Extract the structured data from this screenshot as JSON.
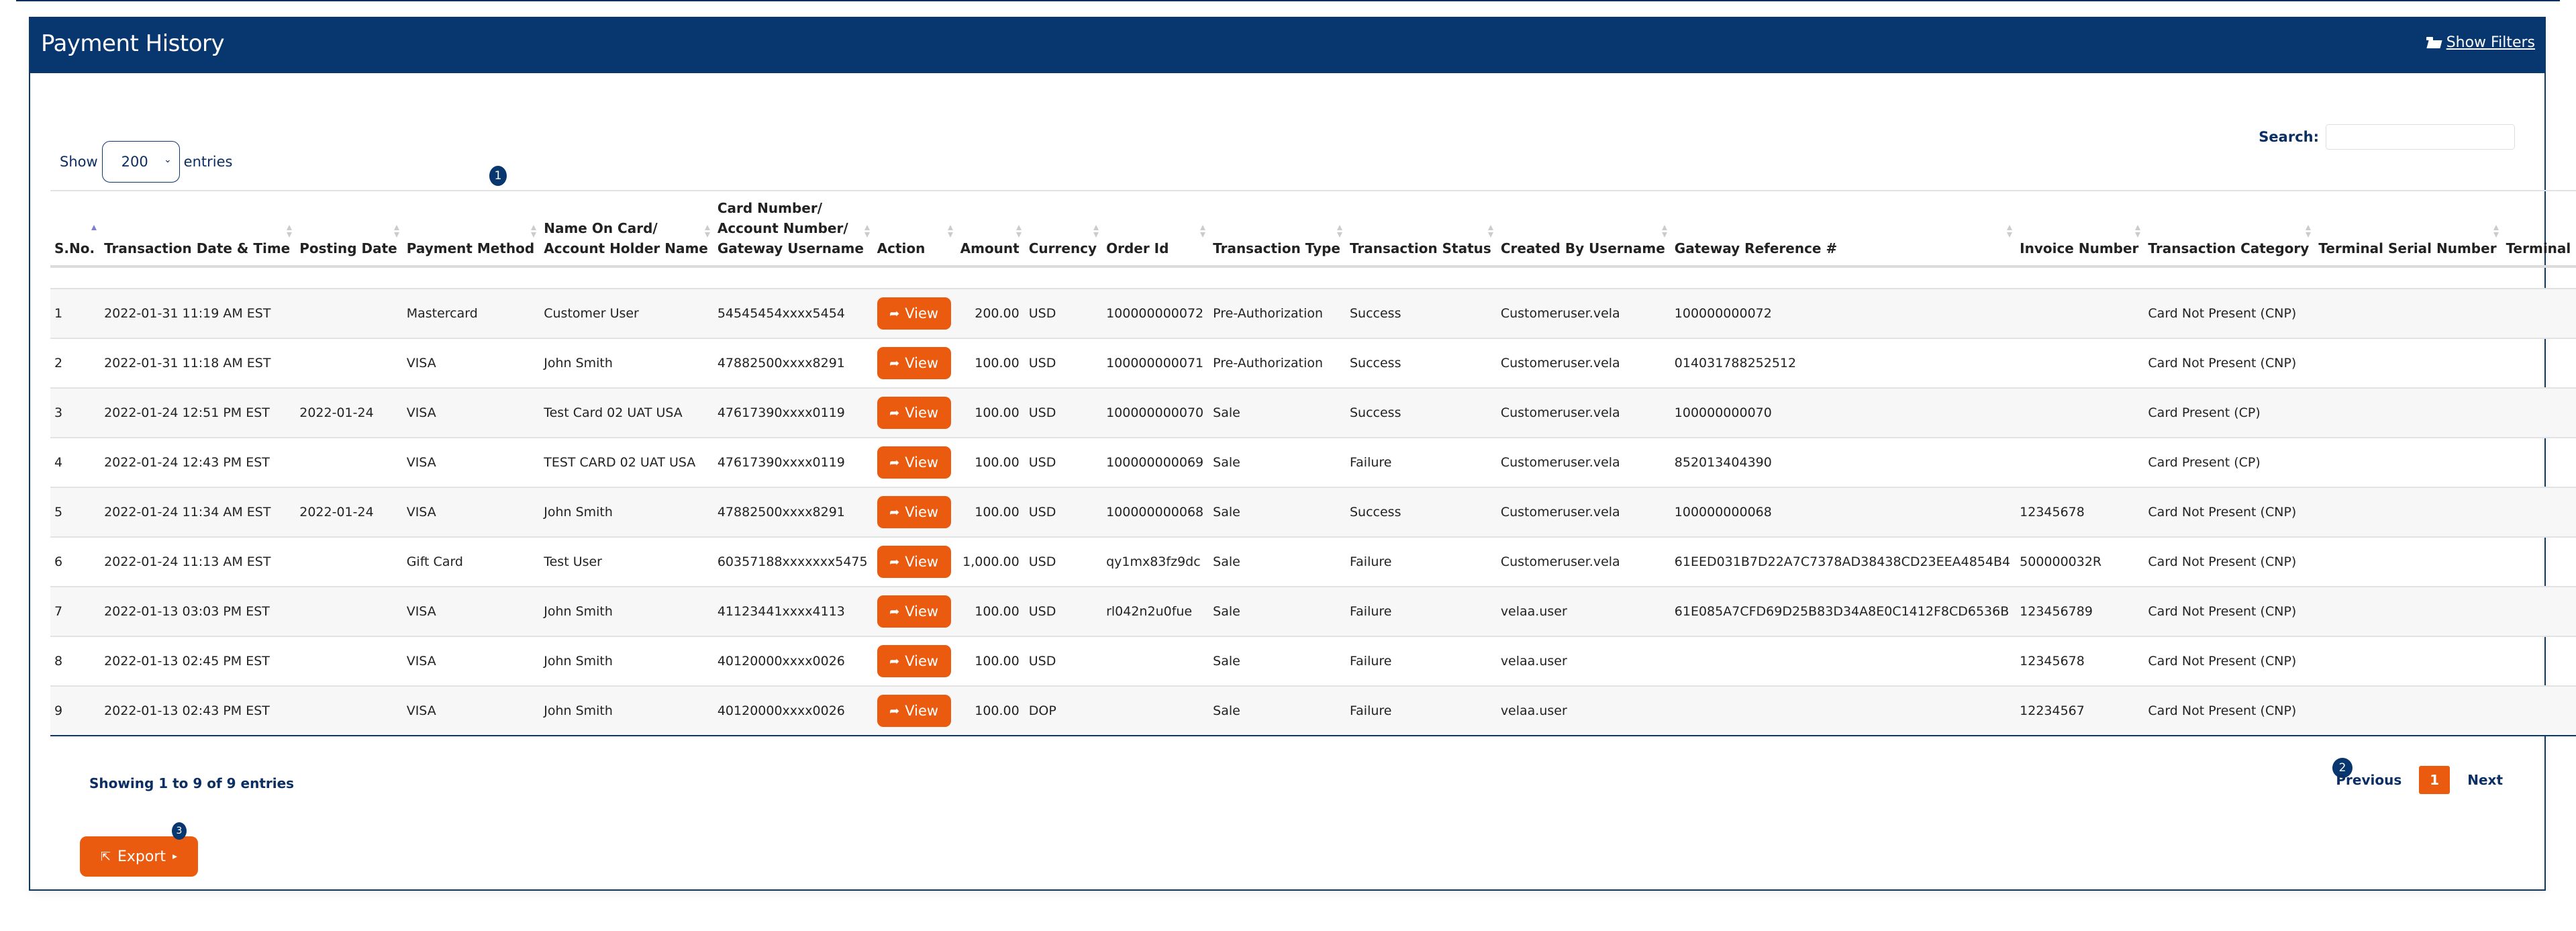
{
  "header": {
    "title": "Payment History",
    "show_filters_label": "Show Filters",
    "show_filters_icon": "folder-open-icon"
  },
  "length_control": {
    "prefix": "Show",
    "selected": "200",
    "suffix": "entries"
  },
  "search": {
    "label": "Search:",
    "value": "",
    "placeholder": ""
  },
  "badges": {
    "one": "1",
    "two": "2",
    "three": "3"
  },
  "table": {
    "columns": [
      {
        "label": "S.No.",
        "sort": "asc"
      },
      {
        "label": "Transaction Date & Time",
        "sort": "both"
      },
      {
        "label": "Posting Date",
        "sort": "both"
      },
      {
        "label": "Payment Method",
        "sort": "both"
      },
      {
        "label": "Name On Card/ Account Holder Name",
        "line1": "Name On Card/",
        "line2": "Account Holder Name",
        "sort": "both"
      },
      {
        "label": "Card Number/ Account Number/ Gateway Username",
        "line1": "Card Number/",
        "line2": "Account Number/",
        "line3": "Gateway Username",
        "sort": "both"
      },
      {
        "label": "Action",
        "sort": "both"
      },
      {
        "label": "Amount",
        "sort": "both"
      },
      {
        "label": "Currency",
        "sort": "both"
      },
      {
        "label": "Order Id",
        "sort": "both"
      },
      {
        "label": "Transaction Type",
        "sort": "both"
      },
      {
        "label": "Transaction Status",
        "sort": "both"
      },
      {
        "label": "Created By Username",
        "sort": "both"
      },
      {
        "label": "Gateway Reference #",
        "sort": "both"
      },
      {
        "label": "Invoice Number",
        "sort": "both"
      },
      {
        "label": "Transaction Category",
        "sort": "both"
      },
      {
        "label": "Terminal Serial Number",
        "sort": "both"
      },
      {
        "label": "Terminal Entry Mode",
        "sort": "both"
      }
    ],
    "view_label": "View",
    "rows": [
      {
        "sno": "1",
        "datetime": "2022-01-31 11:19 AM EST",
        "posting": "",
        "method": "Mastercard",
        "name": "Customer User",
        "card": "54545454xxxx5454",
        "amount": "200.00",
        "currency": "USD",
        "order": "100000000072",
        "type": "Pre-Authorization",
        "status": "Success",
        "created_by": "Customeruser.vela",
        "gateway_ref": "100000000072",
        "invoice": "",
        "category": "Card Not Present (CNP)",
        "serial": "",
        "entry_mode": ""
      },
      {
        "sno": "2",
        "datetime": "2022-01-31 11:18 AM EST",
        "posting": "",
        "method": "VISA",
        "name": "John Smith",
        "card": "47882500xxxx8291",
        "amount": "100.00",
        "currency": "USD",
        "order": "100000000071",
        "type": "Pre-Authorization",
        "status": "Success",
        "created_by": "Customeruser.vela",
        "gateway_ref": "014031788252512",
        "invoice": "",
        "category": "Card Not Present (CNP)",
        "serial": "",
        "entry_mode": ""
      },
      {
        "sno": "3",
        "datetime": "2022-01-24 12:51 PM EST",
        "posting": "2022-01-24",
        "method": "VISA",
        "name": "Test Card 02 UAT USA",
        "card": "47617390xxxx0119",
        "amount": "100.00",
        "currency": "USD",
        "order": "100000000070",
        "type": "Sale",
        "status": "Success",
        "created_by": "Customeruser.vela",
        "gateway_ref": "100000000070",
        "invoice": "",
        "category": "Card Present (CP)",
        "serial": "",
        "entry_mode": ""
      },
      {
        "sno": "4",
        "datetime": "2022-01-24 12:43 PM EST",
        "posting": "",
        "method": "VISA",
        "name": "TEST CARD 02 UAT USA",
        "card": "47617390xxxx0119",
        "amount": "100.00",
        "currency": "USD",
        "order": "100000000069",
        "type": "Sale",
        "status": "Failure",
        "created_by": "Customeruser.vela",
        "gateway_ref": "852013404390",
        "invoice": "",
        "category": "Card Present (CP)",
        "serial": "",
        "entry_mode": ""
      },
      {
        "sno": "5",
        "datetime": "2022-01-24 11:34 AM EST",
        "posting": "2022-01-24",
        "method": "VISA",
        "name": "John Smith",
        "card": "47882500xxxx8291",
        "amount": "100.00",
        "currency": "USD",
        "order": "100000000068",
        "type": "Sale",
        "status": "Success",
        "created_by": "Customeruser.vela",
        "gateway_ref": "100000000068",
        "invoice": "12345678",
        "category": "Card Not Present (CNP)",
        "serial": "",
        "entry_mode": ""
      },
      {
        "sno": "6",
        "datetime": "2022-01-24 11:13 AM EST",
        "posting": "",
        "method": "Gift Card",
        "name": "Test User",
        "card": "60357188xxxxxxx5475",
        "amount": "1,000.00",
        "currency": "USD",
        "order": "qy1mx83fz9dc",
        "type": "Sale",
        "status": "Failure",
        "created_by": "Customeruser.vela",
        "gateway_ref": "61EED031B7D22A7C7378AD38438CD23EEA4854B4",
        "invoice": "500000032R",
        "category": "Card Not Present (CNP)",
        "serial": "",
        "entry_mode": ""
      },
      {
        "sno": "7",
        "datetime": "2022-01-13 03:03 PM EST",
        "posting": "",
        "method": "VISA",
        "name": "John Smith",
        "card": "41123441xxxx4113",
        "amount": "100.00",
        "currency": "USD",
        "order": "rl042n2u0fue",
        "type": "Sale",
        "status": "Failure",
        "created_by": "velaa.user",
        "gateway_ref": "61E085A7CFD69D25B83D34A8E0C1412F8CD6536B",
        "invoice": "123456789",
        "category": "Card Not Present (CNP)",
        "serial": "",
        "entry_mode": ""
      },
      {
        "sno": "8",
        "datetime": "2022-01-13 02:45 PM EST",
        "posting": "",
        "method": "VISA",
        "name": "John Smith",
        "card": "40120000xxxx0026",
        "amount": "100.00",
        "currency": "USD",
        "order": "",
        "type": "Sale",
        "status": "Failure",
        "created_by": "velaa.user",
        "gateway_ref": "",
        "invoice": "12345678",
        "category": "Card Not Present (CNP)",
        "serial": "",
        "entry_mode": ""
      },
      {
        "sno": "9",
        "datetime": "2022-01-13 02:43 PM EST",
        "posting": "",
        "method": "VISA",
        "name": "John Smith",
        "card": "40120000xxxx0026",
        "amount": "100.00",
        "currency": "DOP",
        "order": "",
        "type": "Sale",
        "status": "Failure",
        "created_by": "velaa.user",
        "gateway_ref": "",
        "invoice": "12234567",
        "category": "Card Not Present (CNP)",
        "serial": "",
        "entry_mode": ""
      }
    ]
  },
  "footer": {
    "info": "Showing 1 to 9 of 9 entries",
    "previous_label": "Previous",
    "current_page": "1",
    "next_label": "Next",
    "export_label": "Export"
  },
  "colors": {
    "brand_navy": "#08366f",
    "accent_orange": "#ea5b0f",
    "success": "#0c7a0c",
    "failure": "#e33b3b"
  }
}
